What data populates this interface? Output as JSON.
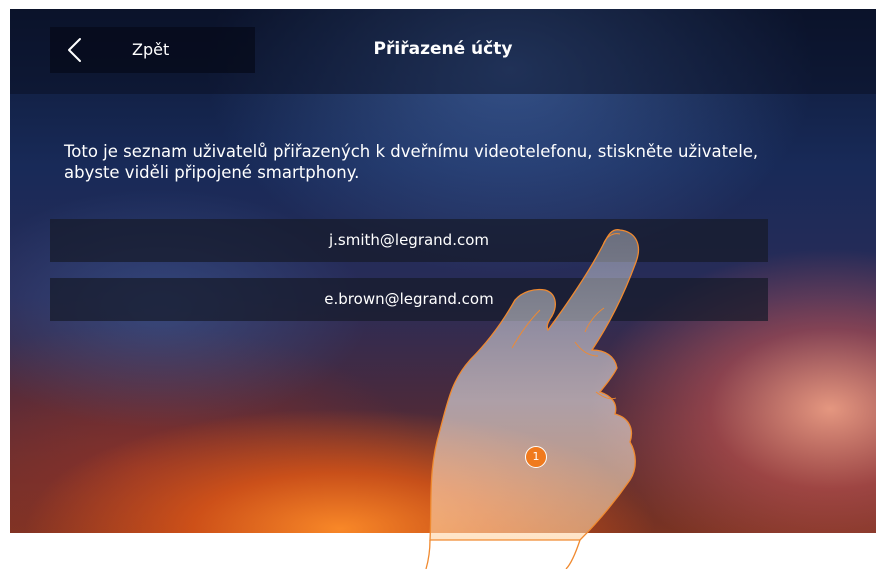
{
  "header": {
    "back_label": "Zpět",
    "title": "Přiřazené účty"
  },
  "icons": {
    "back": "chevron-left-icon",
    "hand": "pointing-hand-icon"
  },
  "main": {
    "description": "Toto je seznam uživatelů přiřazených k dveřnímu videotelefonu, stiskněte uživatele, abyste viděli připojené smartphony.",
    "users": [
      {
        "email": "j.smith@legrand.com"
      },
      {
        "email": "e.brown@legrand.com"
      }
    ]
  },
  "callout": {
    "step_number": "1"
  },
  "colors": {
    "badge": "#f07a1e",
    "text": "#ffffff"
  }
}
